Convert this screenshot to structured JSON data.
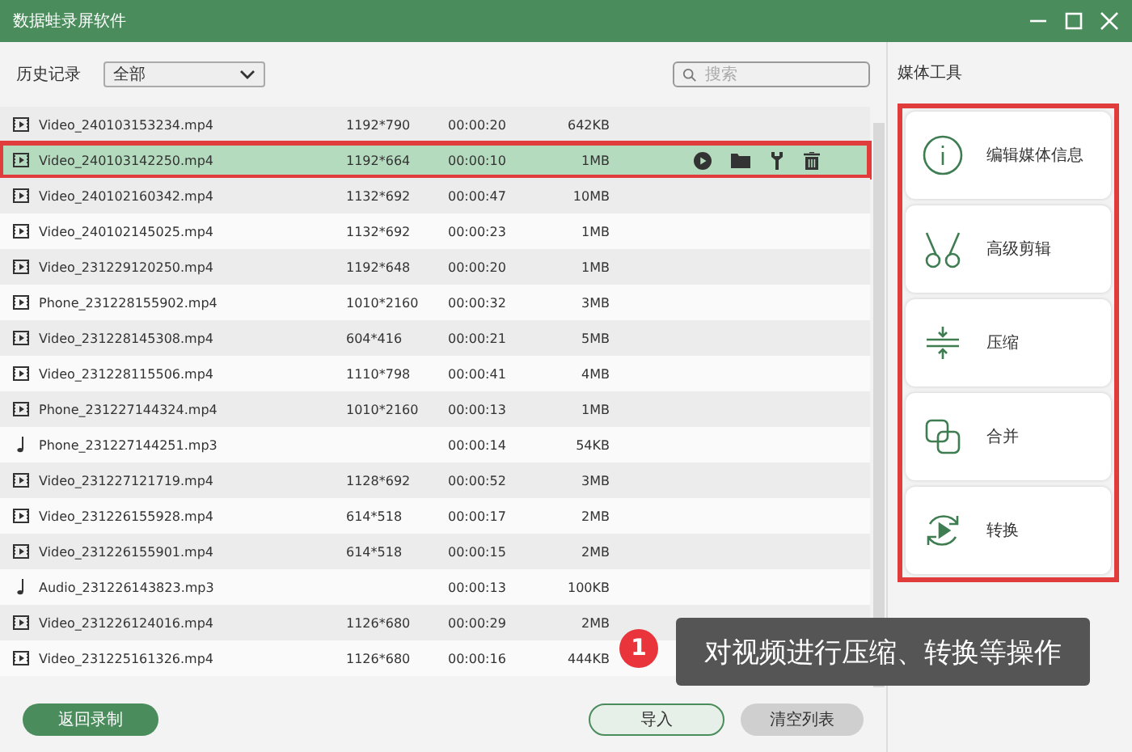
{
  "window": {
    "title": "数据蛙录屏软件"
  },
  "toolbar": {
    "label": "历史记录",
    "filter": "全部",
    "search_placeholder": "搜索"
  },
  "rows": [
    {
      "kind": "video",
      "name": "Video_240103153234.mp4",
      "resolution": "1192*790",
      "duration": "00:00:20",
      "size": "642KB",
      "selected": false
    },
    {
      "kind": "video",
      "name": "Video_240103142250.mp4",
      "resolution": "1192*664",
      "duration": "00:00:10",
      "size": "1MB",
      "selected": true
    },
    {
      "kind": "video",
      "name": "Video_240102160342.mp4",
      "resolution": "1132*692",
      "duration": "00:00:47",
      "size": "10MB",
      "selected": false
    },
    {
      "kind": "video",
      "name": "Video_240102145025.mp4",
      "resolution": "1132*692",
      "duration": "00:00:23",
      "size": "1MB",
      "selected": false
    },
    {
      "kind": "video",
      "name": "Video_231229120250.mp4",
      "resolution": "1192*648",
      "duration": "00:00:20",
      "size": "1MB",
      "selected": false
    },
    {
      "kind": "video",
      "name": "Phone_231228155902.mp4",
      "resolution": "1010*2160",
      "duration": "00:00:32",
      "size": "3MB",
      "selected": false
    },
    {
      "kind": "video",
      "name": "Video_231228145308.mp4",
      "resolution": "604*416",
      "duration": "00:00:21",
      "size": "5MB",
      "selected": false
    },
    {
      "kind": "video",
      "name": "Video_231228115506.mp4",
      "resolution": "1110*798",
      "duration": "00:00:41",
      "size": "4MB",
      "selected": false
    },
    {
      "kind": "video",
      "name": "Phone_231227144324.mp4",
      "resolution": "1010*2160",
      "duration": "00:00:13",
      "size": "1MB",
      "selected": false
    },
    {
      "kind": "audio",
      "name": "Phone_231227144251.mp3",
      "duration": "00:00:14",
      "size": "54KB",
      "selected": false
    },
    {
      "kind": "video",
      "name": "Video_231227121719.mp4",
      "resolution": "1128*692",
      "duration": "00:00:52",
      "size": "3MB",
      "selected": false
    },
    {
      "kind": "video",
      "name": "Video_231226155928.mp4",
      "resolution": "614*518",
      "duration": "00:00:17",
      "size": "2MB",
      "selected": false
    },
    {
      "kind": "video",
      "name": "Video_231226155901.mp4",
      "resolution": "614*518",
      "duration": "00:00:15",
      "size": "2MB",
      "selected": false
    },
    {
      "kind": "audio",
      "name": "Audio_231226143823.mp3",
      "duration": "00:00:13",
      "size": "100KB",
      "selected": false
    },
    {
      "kind": "video",
      "name": "Video_231226124016.mp4",
      "resolution": "1126*680",
      "duration": "00:00:29",
      "size": "2MB",
      "selected": false
    },
    {
      "kind": "video",
      "name": "Video_231225161326.mp4",
      "resolution": "1126*680",
      "duration": "00:00:16",
      "size": "444KB",
      "selected": false
    }
  ],
  "tools": {
    "title": "媒体工具",
    "highlighted": true,
    "items": [
      {
        "kind": "info",
        "label": "编辑媒体信息"
      },
      {
        "kind": "cut",
        "label": "高级剪辑"
      },
      {
        "kind": "compress",
        "label": "压缩"
      },
      {
        "kind": "merge",
        "label": "合并"
      },
      {
        "kind": "convert",
        "label": "转换"
      }
    ]
  },
  "buttons": [
    {
      "label": "返回录制",
      "kind": "primary"
    },
    {
      "label": "导入",
      "kind": "outline"
    },
    {
      "label": "清空列表",
      "kind": "muted"
    }
  ],
  "callout": {
    "number": "1",
    "text": "对视频进行压缩、转换等操作"
  }
}
